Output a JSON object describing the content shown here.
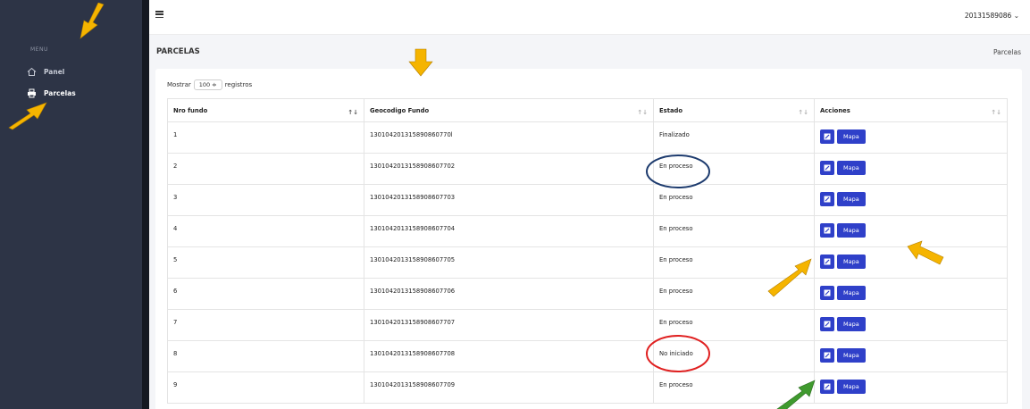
{
  "sidebar": {
    "menu_label": "MENU",
    "items": [
      {
        "label": "Panel",
        "icon": "home-icon"
      },
      {
        "label": "Parcelas",
        "icon": "printer-icon"
      }
    ],
    "background": "#2d3446"
  },
  "topbar": {
    "user": "20131589086 ⌄"
  },
  "page": {
    "title": "PARCELAS",
    "breadcrumb": "Parcelas"
  },
  "table_controls": {
    "show_label": "Mostrar",
    "page_size": "100 ≑",
    "records_label": "registros"
  },
  "table": {
    "headers": [
      "Nro fundo",
      "Geocodigo Fundo",
      "Estado",
      "Acciones"
    ],
    "sort_icons": [
      "↑↓",
      "↑↓",
      "↑↓",
      "↑↓"
    ],
    "rows": [
      {
        "nro": "1",
        "geo": "130104201315890860770l",
        "estado": "Finalizado",
        "mapa": "Mapa"
      },
      {
        "nro": "2",
        "geo": "1301042013158908607702",
        "estado": "En proceso",
        "mapa": "Mapa"
      },
      {
        "nro": "3",
        "geo": "1301042013158908607703",
        "estado": "En proceso",
        "mapa": "Mapa"
      },
      {
        "nro": "4",
        "geo": "1301042013158908607704",
        "estado": "En proceso",
        "mapa": "Mapa"
      },
      {
        "nro": "5",
        "geo": "1301042013158908607705",
        "estado": "En proceso",
        "mapa": "Mapa"
      },
      {
        "nro": "6",
        "geo": "1301042013158908607706",
        "estado": "En proceso",
        "mapa": "Mapa"
      },
      {
        "nro": "7",
        "geo": "1301042013158908607707",
        "estado": "En proceso",
        "mapa": "Mapa"
      },
      {
        "nro": "8",
        "geo": "1301042013158908607708",
        "estado": "No iniciado",
        "mapa": "Mapa"
      },
      {
        "nro": "9",
        "geo": "1301042013158908607709",
        "estado": "En proceso",
        "mapa": "Mapa"
      }
    ]
  },
  "colors": {
    "button": "#2f40c9",
    "annotation_arrow": "#f5b400",
    "annotation_arrow_green": "#3f9a2e",
    "circle_blue": "#1d3b6e",
    "circle_red": "#e02020"
  }
}
